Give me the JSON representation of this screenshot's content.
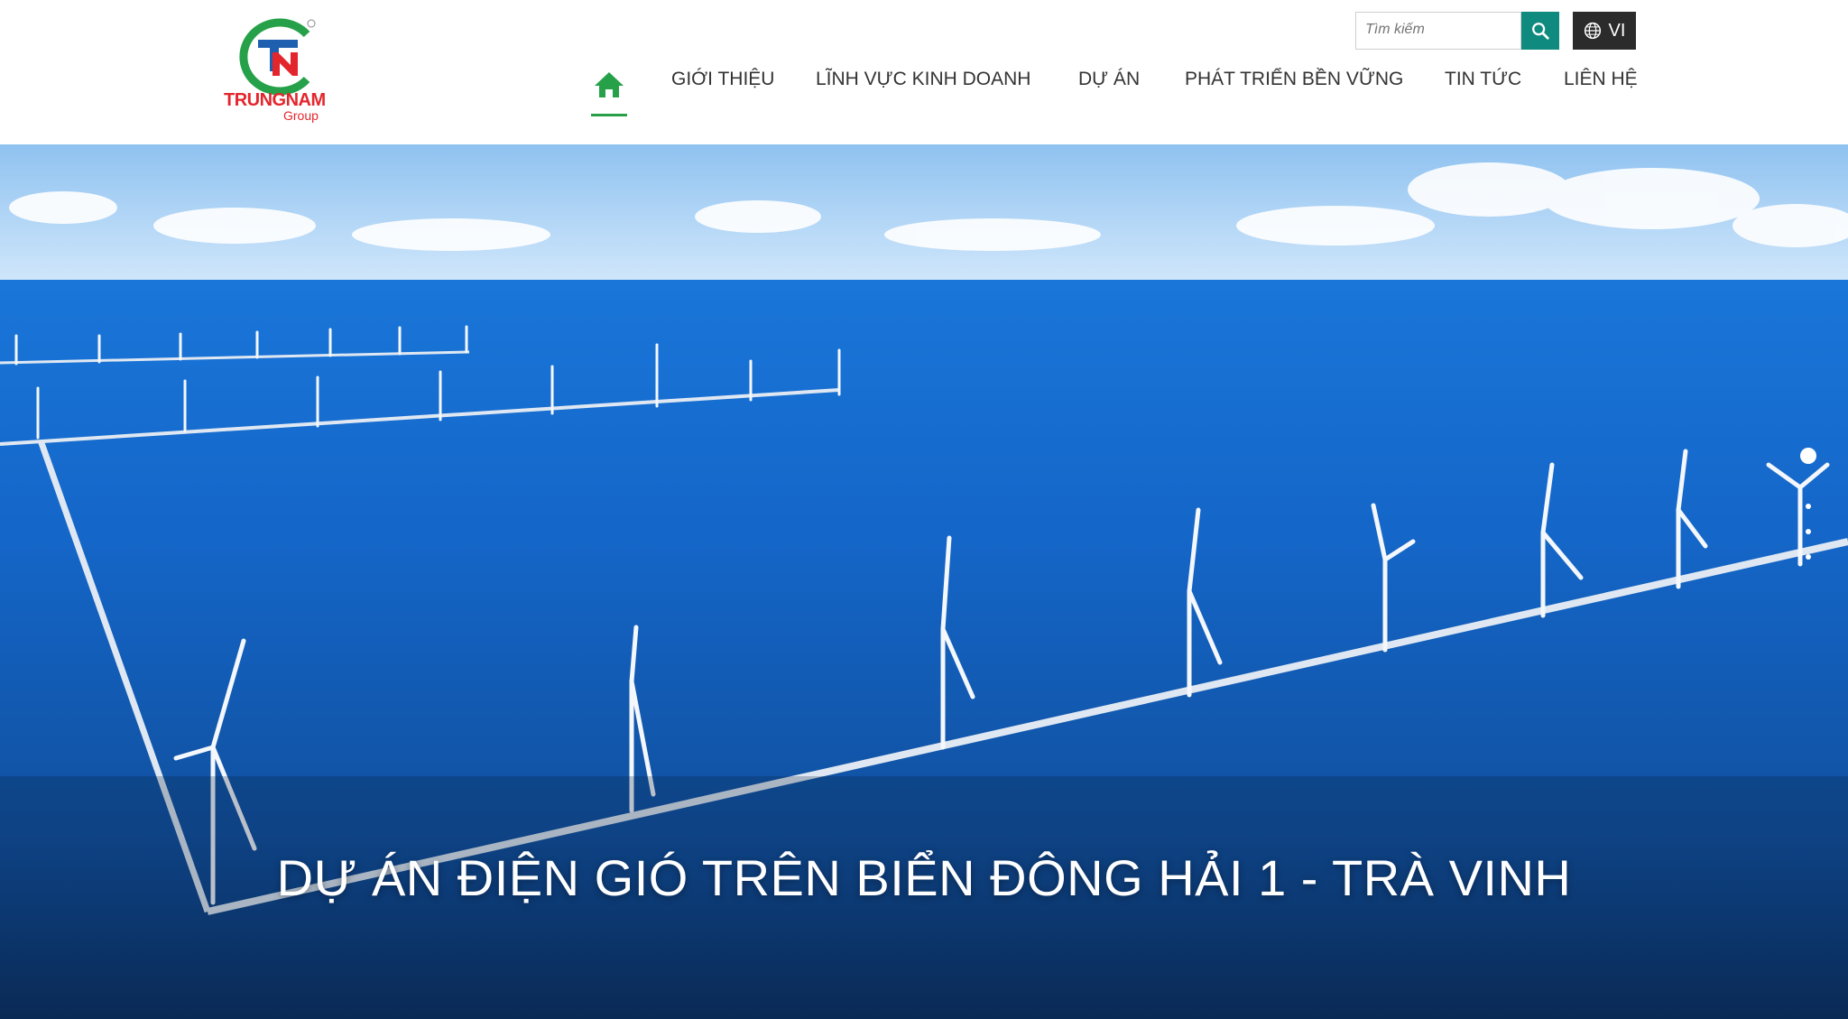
{
  "brand": {
    "name": "TRUNGNAM",
    "sub": "Group",
    "colors": {
      "green": "#27a149",
      "red": "#e3262c",
      "blue": "#1f5fb0"
    }
  },
  "search": {
    "placeholder": "Tìm kiếm",
    "icon": "search-icon"
  },
  "language": {
    "label": "VI",
    "icon": "globe-icon"
  },
  "nav": {
    "home_icon": "home-icon",
    "items": [
      {
        "label": "GIỚI THIỆU"
      },
      {
        "label": "LĨNH VỰC KINH DOANH"
      },
      {
        "label": "DỰ ÁN"
      },
      {
        "label": "PHÁT TRIỂN BỀN VỮNG"
      },
      {
        "label": "TIN TỨC"
      },
      {
        "label": "LIÊN HỆ"
      }
    ],
    "active_color": "#27a149"
  },
  "hero": {
    "title": "DỰ ÁN ĐIỆN GIÓ TRÊN BIỂN ĐÔNG HẢI 1 - TRÀ VINH",
    "slide_count": 5,
    "active_slide": 1
  }
}
